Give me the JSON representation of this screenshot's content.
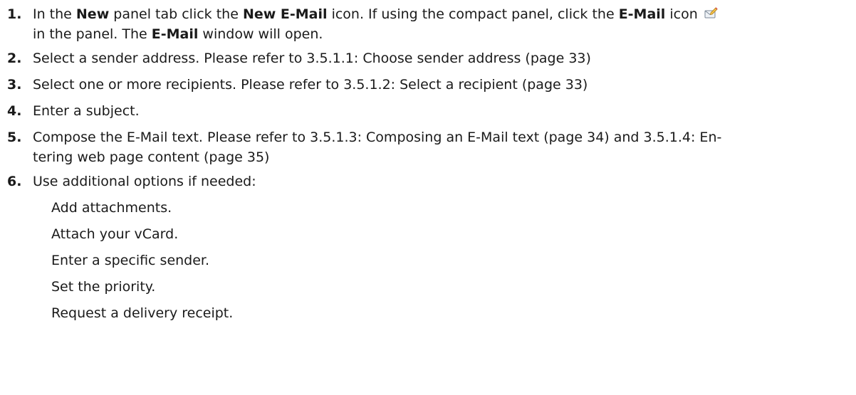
{
  "steps": [
    {
      "number": "1.",
      "t1": "In the ",
      "b1": "New",
      "t2": " panel tab click the ",
      "b2": "New E-Mail",
      "t3": " icon. If using the compact panel, click the ",
      "b3": "E-Mail",
      "t4": " icon ",
      "icon": "email-compose-icon",
      "t5": "in the panel. The ",
      "b4": "E-Mail",
      "t6": " window will open."
    },
    {
      "number": "2.",
      "text": "Select a sender address. Please refer to 3.5.1.1: Choose sender address (page 33)"
    },
    {
      "number": "3.",
      "text": "Select one or more recipients. Please refer to 3.5.1.2: Select a recipient (page 33)"
    },
    {
      "number": "4.",
      "text": "Enter a subject."
    },
    {
      "number": "5.",
      "line1": "Compose the E-Mail text. Please refer to 3.5.1.3: Composing an E-Mail text (page 34) and 3.5.1.4: En-",
      "line2": "tering web page content (page 35)"
    },
    {
      "number": "6.",
      "text": "Use additional options if needed:",
      "options": [
        "Add attachments.",
        "Attach your vCard.",
        "Enter a specific sender.",
        "Set the priority.",
        "Request a delivery receipt."
      ]
    }
  ]
}
